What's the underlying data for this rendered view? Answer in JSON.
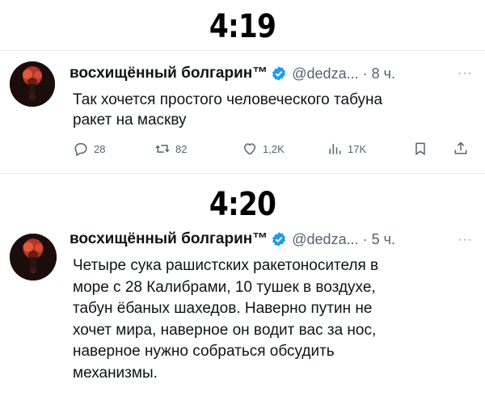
{
  "headers": {
    "first": "4:19",
    "second": "4:20"
  },
  "tweet1": {
    "name": "восхищённый болгарин™",
    "handle": "@dedza...",
    "time": "· 8 ч.",
    "more": "···",
    "lines": [
      "Так хочется простого человеческого табуна",
      "ракет на маскву"
    ],
    "replies": "28",
    "retweets": "82",
    "likes": "1,2K",
    "views": "17K"
  },
  "tweet2": {
    "name": "восхищённый болгарин™",
    "handle": "@dedza...",
    "time": "· 5 ч.",
    "more": "···",
    "lines": [
      "Четыре сука рашистских ракетоносителя в",
      "море с 28 Калибрами, 10 тушек в воздухе,",
      "табун ёбаных шахедов. Наверно путин не",
      "хочет мира, наверное он водит вас за нос,",
      "наверное нужно собраться обсудить",
      "механизмы."
    ]
  },
  "colors": {
    "verified": "#1d9bf0",
    "secondary": "#536471"
  }
}
